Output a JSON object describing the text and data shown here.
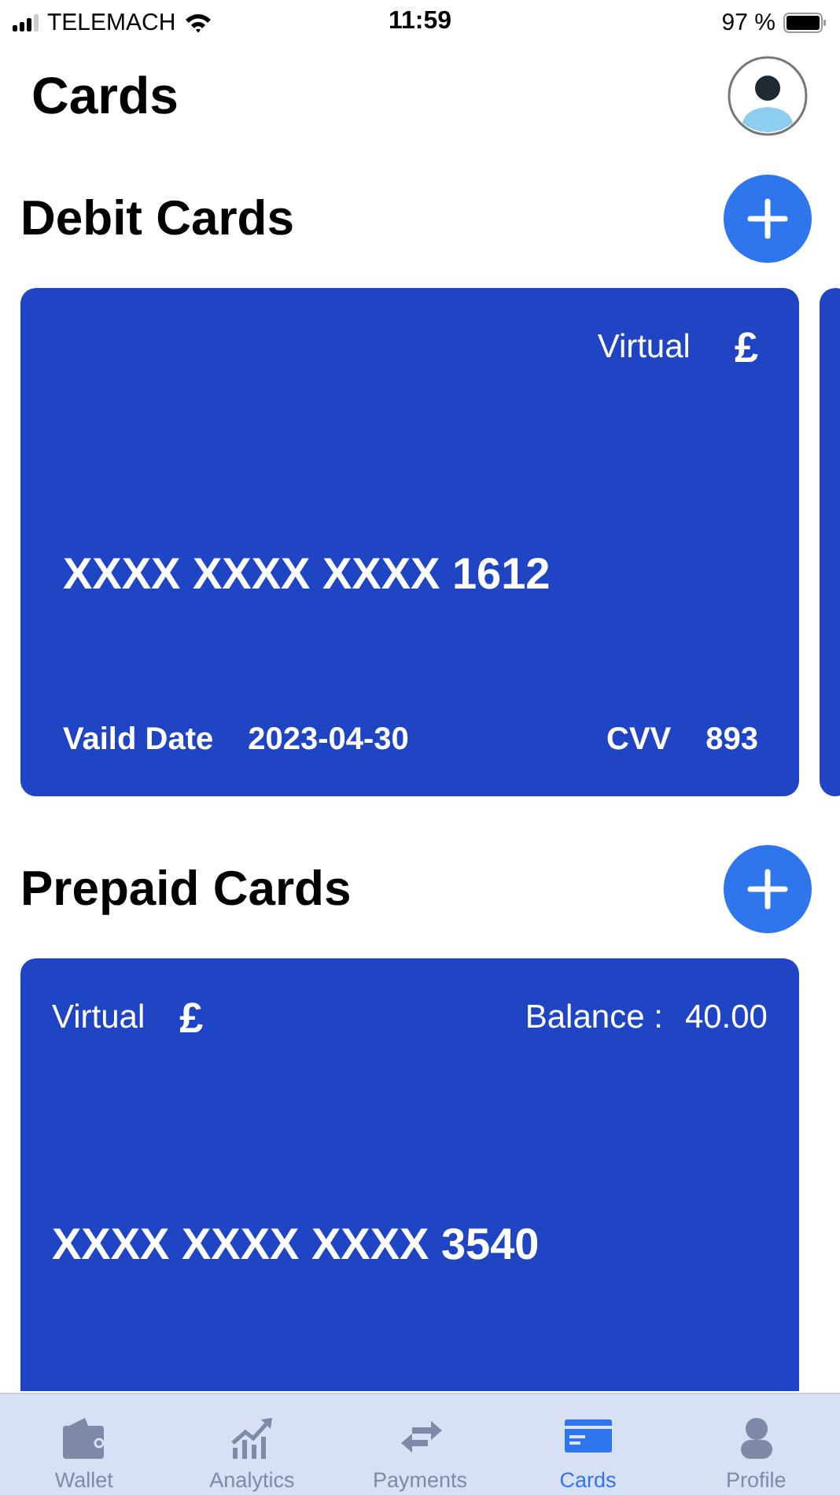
{
  "status_bar": {
    "carrier": "TELEMACH",
    "time": "11:59",
    "battery": "97 %"
  },
  "header": {
    "title": "Cards"
  },
  "sections": [
    {
      "title": "Debit Cards",
      "cards": [
        {
          "kind": "debit",
          "type_label": "Virtual",
          "currency": "£",
          "number": "XXXX XXXX XXXX 1612",
          "valid_label": "Vaild Date",
          "valid_date": "2023-04-30",
          "cvv_label": "CVV",
          "cvv": "893"
        },
        {
          "kind": "peek"
        }
      ]
    },
    {
      "title": "Prepaid Cards",
      "cards": [
        {
          "kind": "prepaid",
          "type_label": "Virtual",
          "currency": "£",
          "balance_label": "Balance :",
          "balance": "40.00",
          "number": "XXXX XXXX XXXX 3540"
        }
      ]
    }
  ],
  "tabs": [
    {
      "kind": "wallet",
      "label": "Wallet",
      "selected": false
    },
    {
      "kind": "analytics",
      "label": "Analytics",
      "selected": false
    },
    {
      "kind": "payments",
      "label": "Payments",
      "selected": false
    },
    {
      "kind": "cards",
      "label": "Cards",
      "selected": true
    },
    {
      "kind": "profile",
      "label": "Profile",
      "selected": false
    }
  ]
}
